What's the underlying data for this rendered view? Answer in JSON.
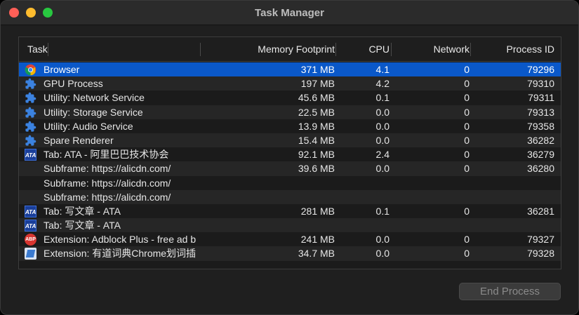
{
  "window": {
    "title": "Task Manager"
  },
  "columns": {
    "task": "Task",
    "memory": "Memory Footprint",
    "cpu": "CPU",
    "network": "Network",
    "pid": "Process ID"
  },
  "rows": [
    {
      "icon": "chrome-icon",
      "task": "Browser",
      "memory": "371 MB",
      "cpu": "4.1",
      "network": "0",
      "pid": "79296",
      "selected": true
    },
    {
      "icon": "puzzle-icon",
      "task": "GPU Process",
      "memory": "197 MB",
      "cpu": "4.2",
      "network": "0",
      "pid": "79310"
    },
    {
      "icon": "puzzle-icon",
      "task": "Utility: Network Service",
      "memory": "45.6 MB",
      "cpu": "0.1",
      "network": "0",
      "pid": "79311"
    },
    {
      "icon": "puzzle-icon",
      "task": "Utility: Storage Service",
      "memory": "22.5 MB",
      "cpu": "0.0",
      "network": "0",
      "pid": "79313"
    },
    {
      "icon": "puzzle-icon",
      "task": "Utility: Audio Service",
      "memory": "13.9 MB",
      "cpu": "0.0",
      "network": "0",
      "pid": "79358"
    },
    {
      "icon": "puzzle-icon",
      "task": "Spare Renderer",
      "memory": "15.4 MB",
      "cpu": "0.0",
      "network": "0",
      "pid": "36282"
    },
    {
      "icon": "ata-icon",
      "task": "Tab: ATA - 阿里巴巴技术协会",
      "memory": "92.1 MB",
      "cpu": "2.4",
      "network": "0",
      "pid": "36279"
    },
    {
      "icon": "",
      "task": "Subframe: https://alicdn.com/",
      "memory": "39.6 MB",
      "cpu": "0.0",
      "network": "0",
      "pid": "36280"
    },
    {
      "icon": "",
      "task": "Subframe: https://alicdn.com/",
      "memory": "",
      "cpu": "",
      "network": "",
      "pid": ""
    },
    {
      "icon": "",
      "task": "Subframe: https://alicdn.com/",
      "memory": "",
      "cpu": "",
      "network": "",
      "pid": ""
    },
    {
      "icon": "ata-icon",
      "task": "Tab: 写文章 - ATA",
      "memory": "281 MB",
      "cpu": "0.1",
      "network": "0",
      "pid": "36281"
    },
    {
      "icon": "ata-icon",
      "task": "Tab: 写文章 - ATA",
      "memory": "",
      "cpu": "",
      "network": "",
      "pid": ""
    },
    {
      "icon": "abp-icon",
      "task": "Extension: Adblock Plus - free ad b",
      "memory": "241 MB",
      "cpu": "0.0",
      "network": "0",
      "pid": "79327"
    },
    {
      "icon": "dictionary-icon",
      "task": "Extension: 有道词典Chrome划词插",
      "memory": "34.7 MB",
      "cpu": "0.0",
      "network": "0",
      "pid": "79328"
    }
  ],
  "icon_glyphs": {
    "ata": "ATA",
    "abp": "ABP"
  },
  "end_process": {
    "label": "End Process",
    "enabled": false
  },
  "colors": {
    "selection": "#0a58c9",
    "close": "#ff5f57",
    "minimize": "#febc2e",
    "maximize": "#28c840"
  }
}
